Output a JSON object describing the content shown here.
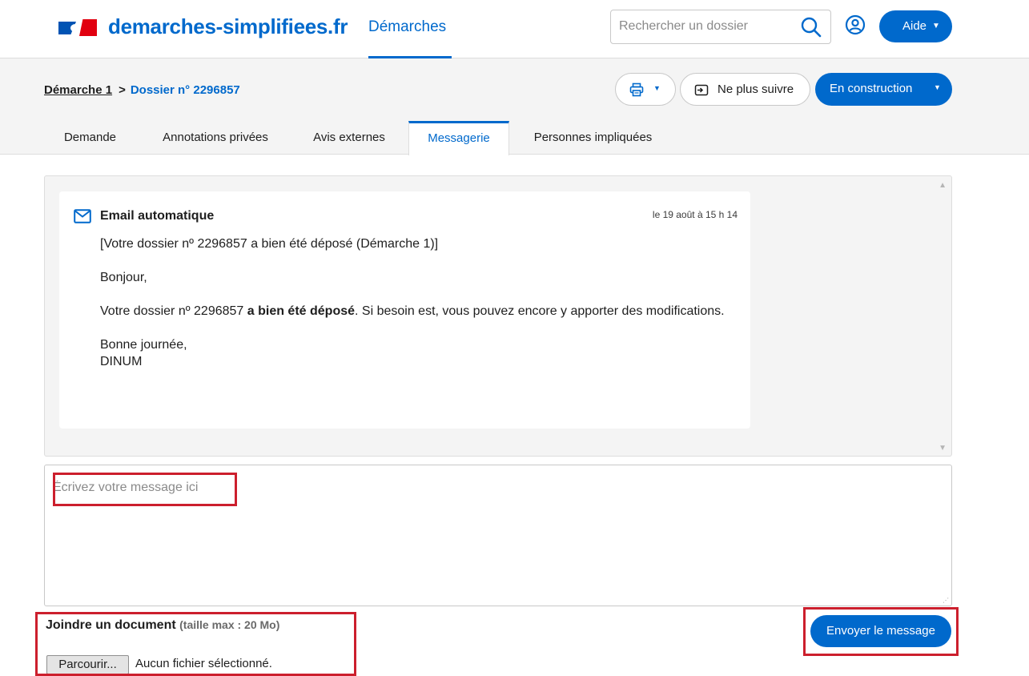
{
  "header": {
    "site_title": "demarches-simplifiees.fr",
    "nav_link": "Démarches",
    "search_placeholder": "Rechercher un dossier",
    "help_label": "Aide",
    "brand_color": "#0069cc",
    "icons": [
      "flag-logo",
      "search-icon",
      "user-icon",
      "caret-down-icon"
    ]
  },
  "breadcrumb": {
    "procedure": "Démarche 1",
    "separator": ">",
    "current": "Dossier n° 2296857"
  },
  "actions": {
    "print_icon": "printer-icon",
    "unfollow_label": "Ne plus suivre",
    "status_label": "En construction"
  },
  "tabs": [
    {
      "label": "Demande",
      "active": false
    },
    {
      "label": "Annotations privées",
      "active": false
    },
    {
      "label": "Avis externes",
      "active": false
    },
    {
      "label": "Messagerie",
      "active": true
    },
    {
      "label": "Personnes impliquées",
      "active": false
    }
  ],
  "message": {
    "sender": "Email automatique",
    "date": "le 19 août à 15 h 14",
    "subject": "[Votre dossier nº 2296857 a bien été déposé (Démarche 1)]",
    "greeting": "Bonjour,",
    "body_start": "Votre dossier nº 2296857 ",
    "body_bold": "a bien été déposé",
    "body_end": ". Si besoin est, vous pouvez encore y apporter des modifications.",
    "closing": "Bonne journée,",
    "signature": "DINUM"
  },
  "compose": {
    "placeholder": "Écrivez votre message ici",
    "attach_title": "Joindre un document",
    "attach_limit": "(taille max : 20 Mo)",
    "browse_label": "Parcourir...",
    "no_file_label": "Aucun fichier sélectionné.",
    "send_label": "Envoyer le message"
  },
  "highlight_color": "#cc1f2d"
}
